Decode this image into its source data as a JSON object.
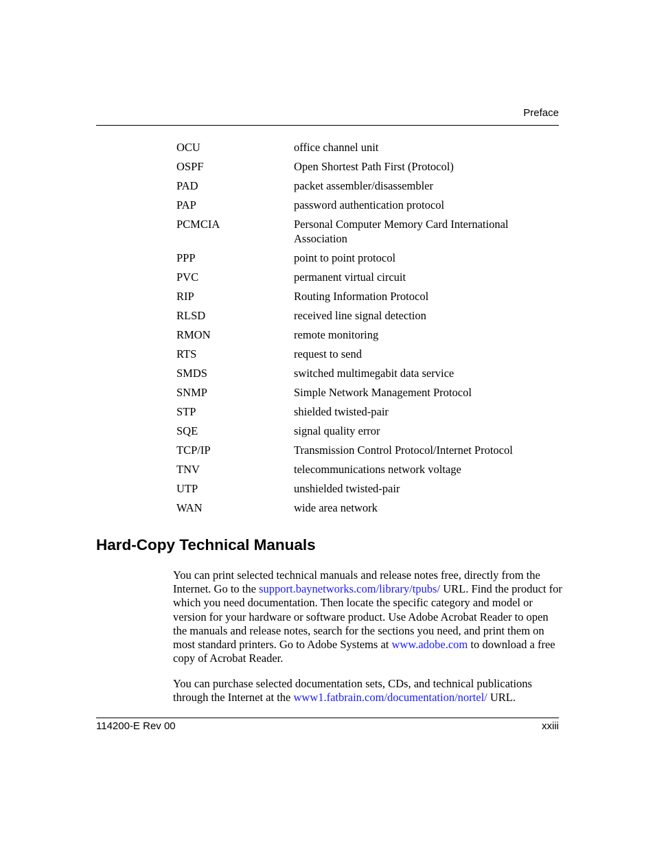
{
  "header": {
    "running_head": "Preface"
  },
  "glossary": [
    {
      "term": "OCU",
      "definition": "office channel unit"
    },
    {
      "term": "OSPF",
      "definition": "Open Shortest Path First (Protocol)"
    },
    {
      "term": "PAD",
      "definition": "packet assembler/disassembler"
    },
    {
      "term": "PAP",
      "definition": "password authentication protocol"
    },
    {
      "term": "PCMCIA",
      "definition": "Personal Computer Memory Card International Association"
    },
    {
      "term": "PPP",
      "definition": "point to point protocol"
    },
    {
      "term": "PVC",
      "definition": "permanent virtual circuit"
    },
    {
      "term": "RIP",
      "definition": "Routing Information Protocol"
    },
    {
      "term": "RLSD",
      "definition": "received line signal detection"
    },
    {
      "term": "RMON",
      "definition": "remote monitoring"
    },
    {
      "term": "RTS",
      "definition": "request to send"
    },
    {
      "term": "SMDS",
      "definition": "switched multimegabit data service"
    },
    {
      "term": "SNMP",
      "definition": "Simple Network Management Protocol"
    },
    {
      "term": "STP",
      "definition": "shielded twisted-pair"
    },
    {
      "term": "SQE",
      "definition": "signal quality error"
    },
    {
      "term": "TCP/IP",
      "definition": "Transmission Control Protocol/Internet Protocol"
    },
    {
      "term": "TNV",
      "definition": "telecommunications network voltage"
    },
    {
      "term": "UTP",
      "definition": "unshielded twisted-pair"
    },
    {
      "term": "WAN",
      "definition": "wide area network"
    }
  ],
  "section": {
    "heading": "Hard-Copy Technical Manuals",
    "p1": {
      "t1": "You can print selected technical manuals and release notes free, directly from the Internet. Go to the ",
      "link1": "support.baynetworks.com/library/tpubs/",
      "t2": " URL. Find the product for which you need documentation. Then locate the specific category and model or version for your hardware or software product. Use Adobe Acrobat Reader to open the manuals and release notes, search for the sections you need, and print them on most standard printers. Go to Adobe Systems at ",
      "link2": "www.adobe.com",
      "t3": " to download a free copy of Acrobat Reader."
    },
    "p2": {
      "t1": "You can purchase selected documentation sets, CDs, and technical publications through the Internet at the ",
      "link1": "www1.fatbrain.com/documentation/nortel/",
      "t2": " URL."
    }
  },
  "footer": {
    "doc_number": "114200-E Rev 00",
    "page_number": "xxiii"
  },
  "colors": {
    "link": "#1a1aff",
    "text": "#000000"
  }
}
